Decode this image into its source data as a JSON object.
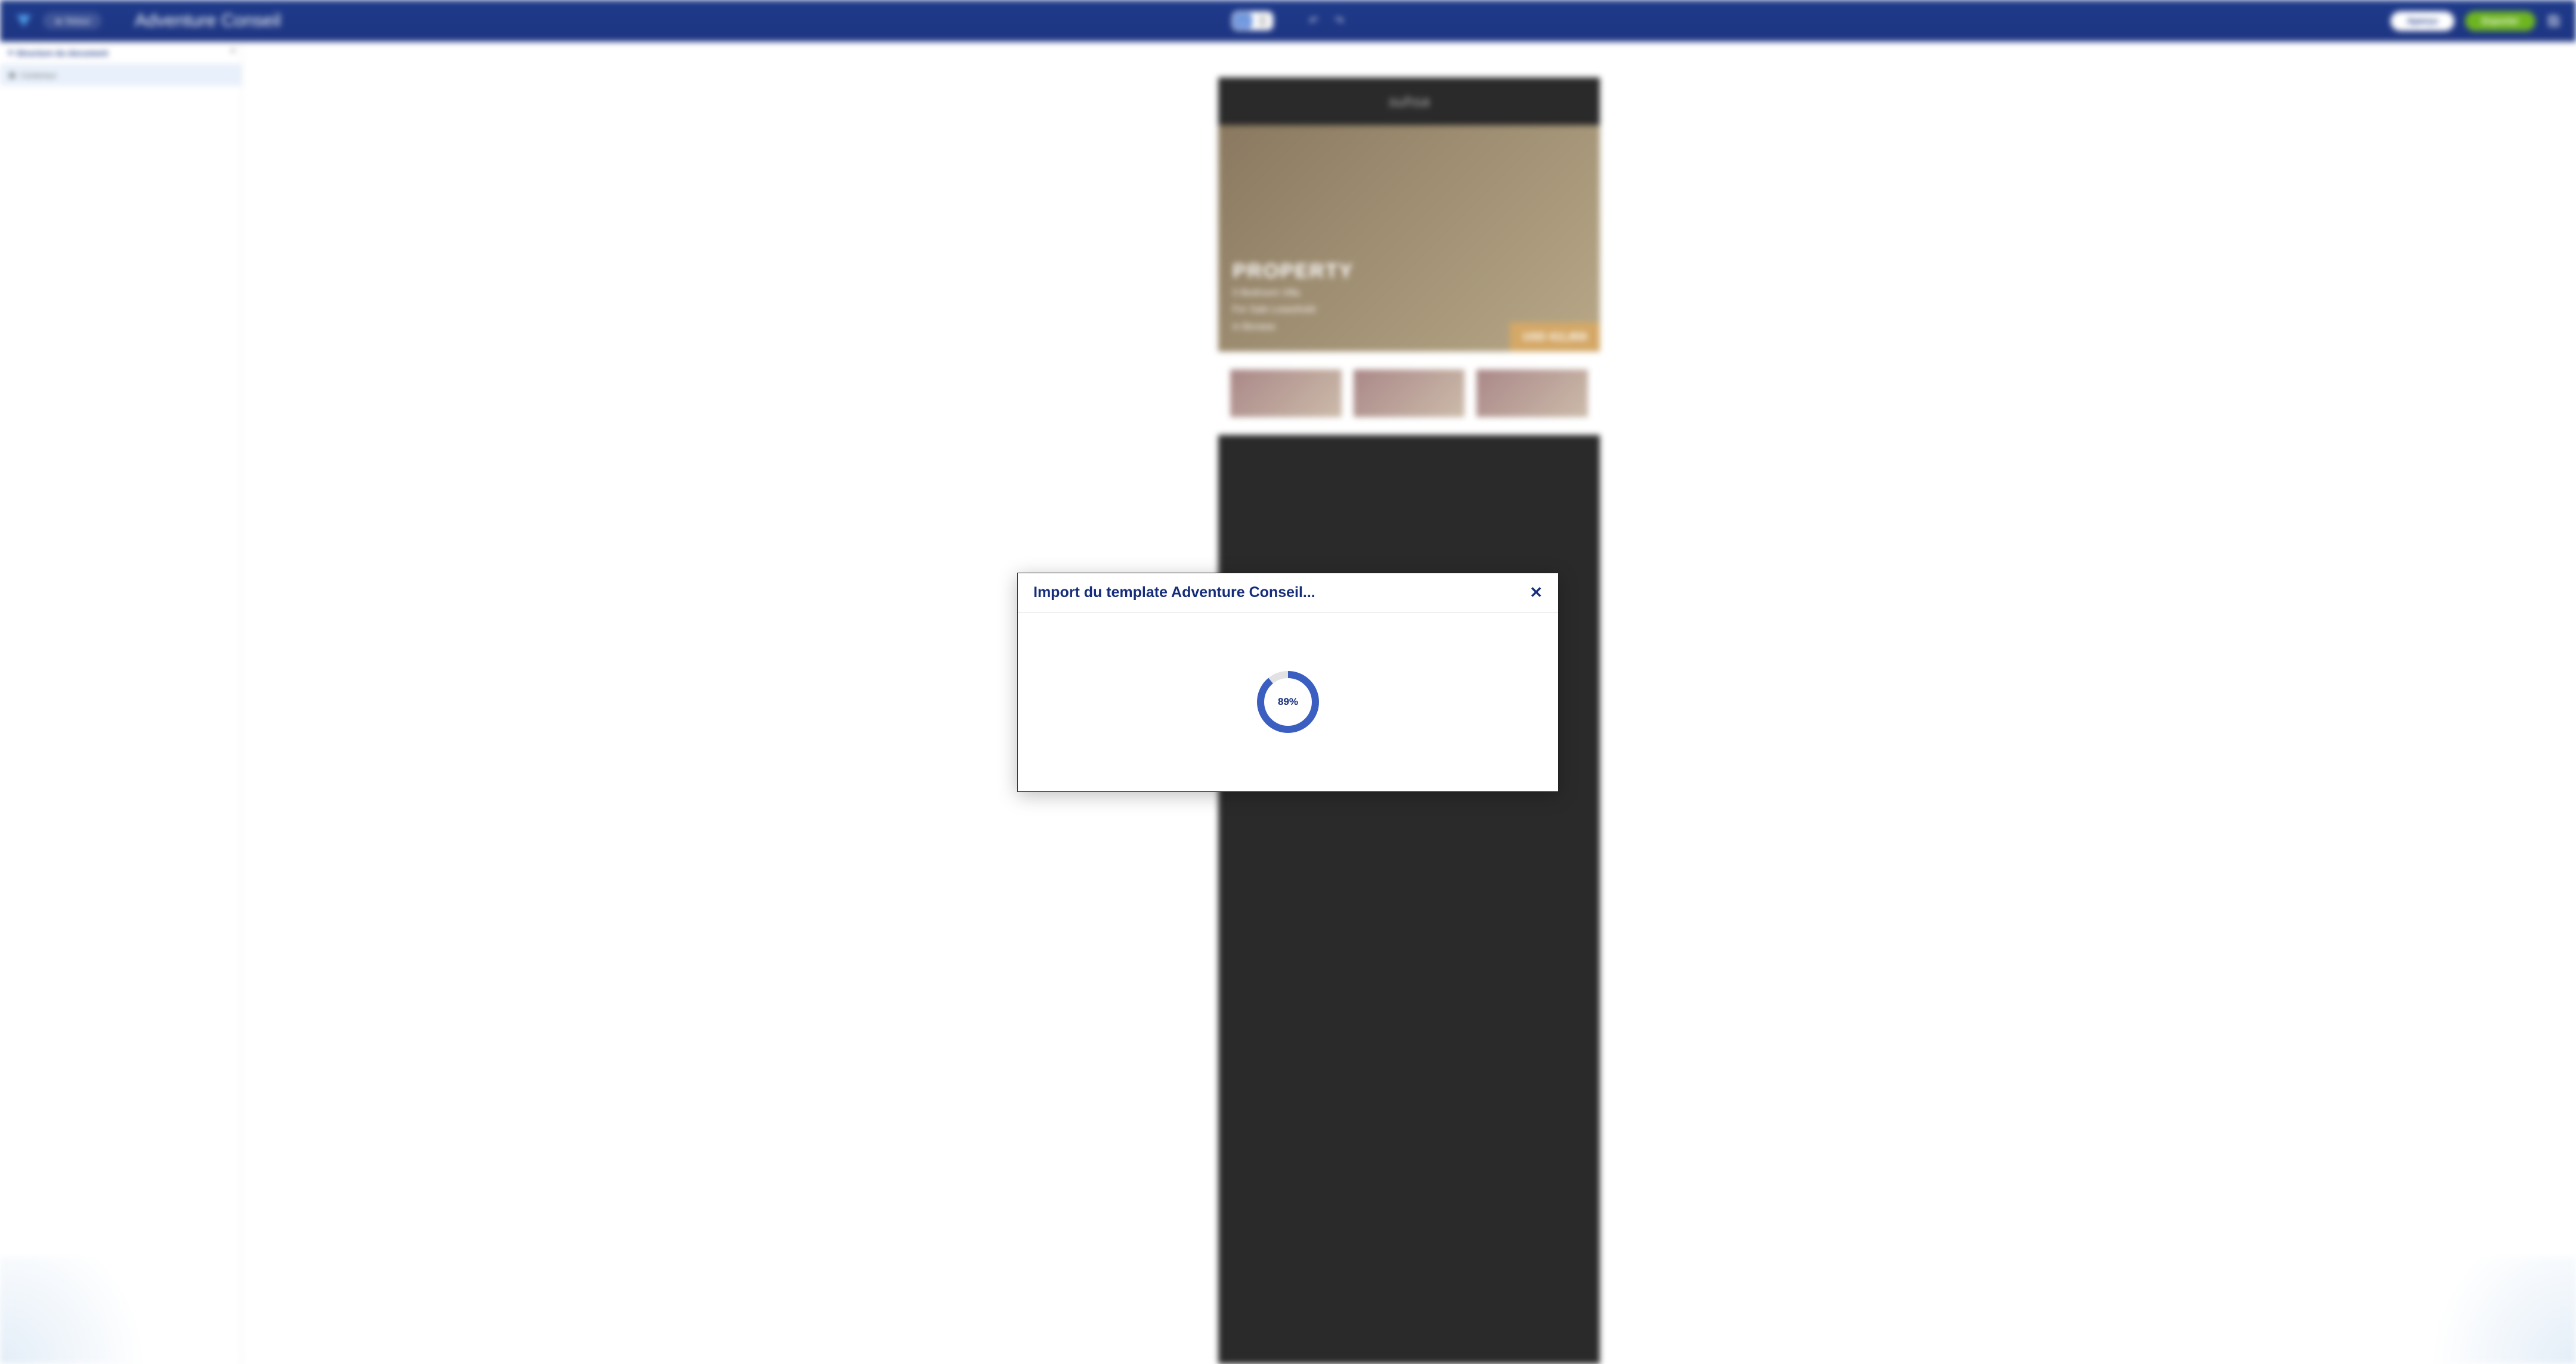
{
  "header": {
    "back_label": "Retour",
    "document_title": "Adventure Conseil",
    "apercu_label": "Aperçu",
    "export_label": "Exporter"
  },
  "sidebar": {
    "title": "Structure du document",
    "items": [
      {
        "label": "Conteneur"
      }
    ]
  },
  "canvas": {
    "brand": "suhsa",
    "hero_title": "PROPERTY",
    "hero_line1": "5 Bedroom Villa",
    "hero_line2": "For Sale Leasehold",
    "hero_line3": "in Berawa",
    "price": "USD 411,859"
  },
  "modal": {
    "title": "Import du template Adventure Conseil...",
    "progress_percent": 89,
    "progress_label": "89%"
  },
  "colors": {
    "primary": "#152d7a",
    "accent_blue": "#3a5fc0",
    "export_green": "#6eb521"
  }
}
